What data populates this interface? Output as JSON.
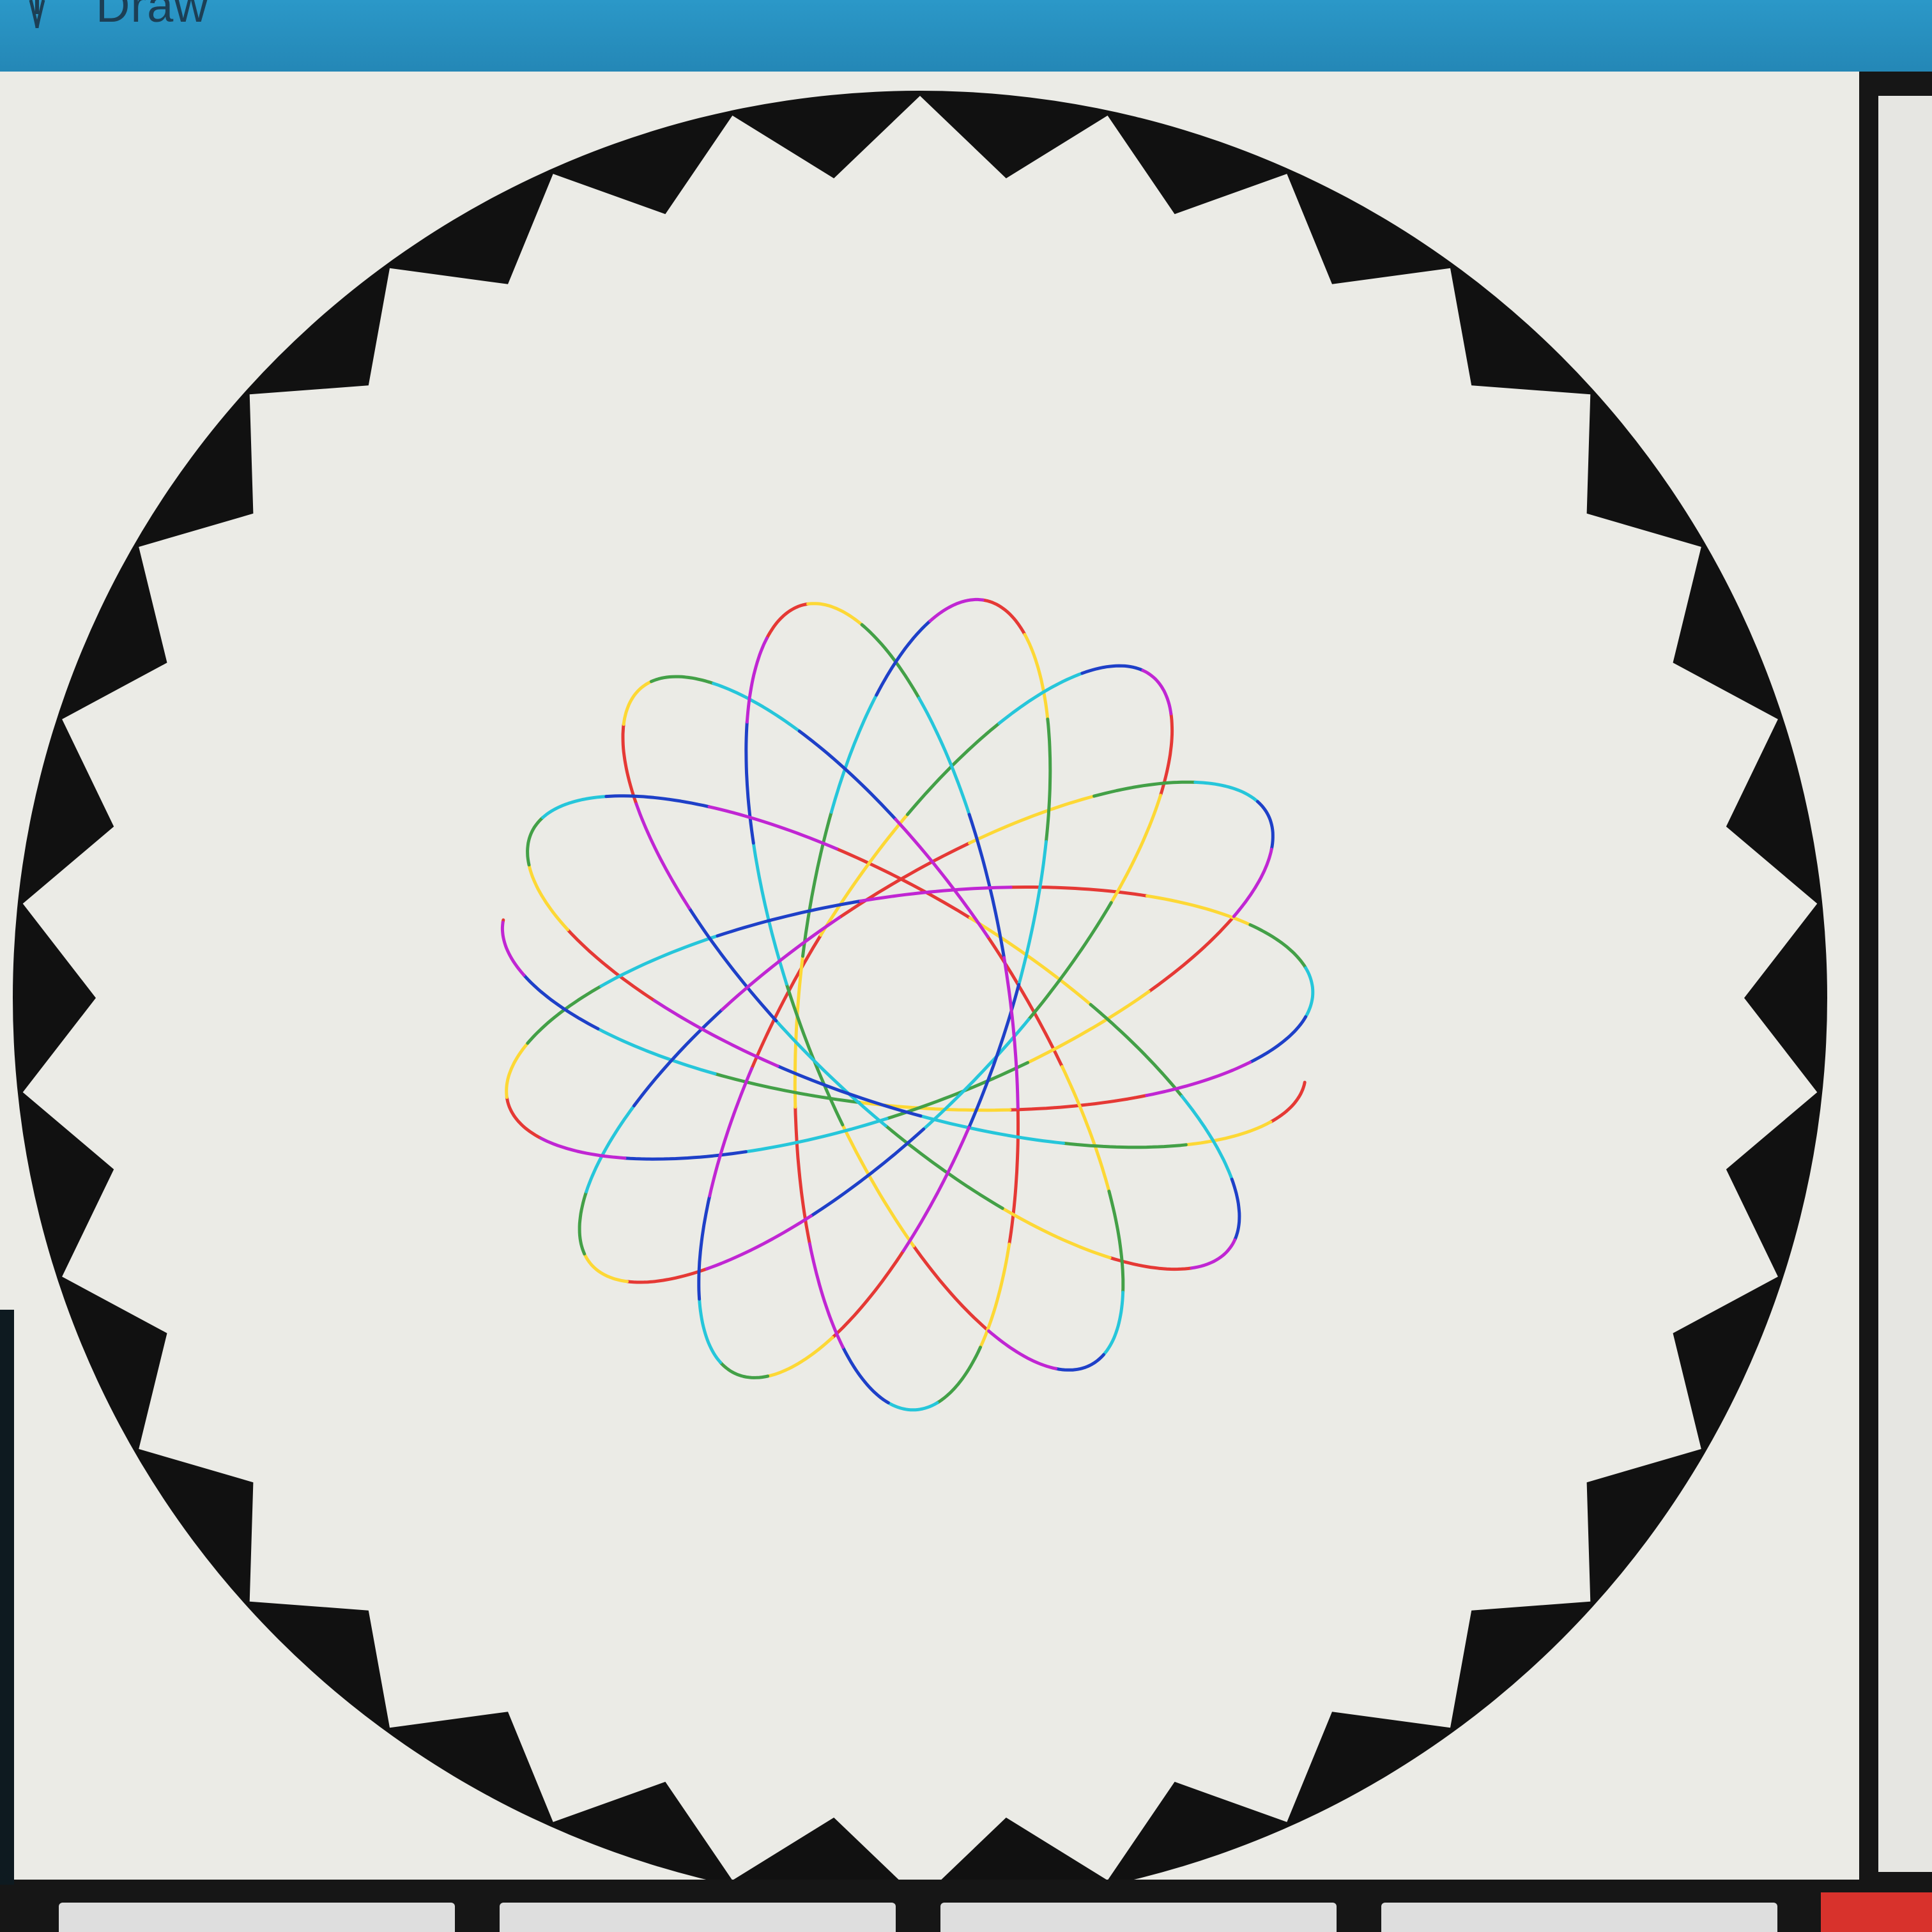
{
  "window": {
    "title": "Draw",
    "icon": "pen-icon"
  },
  "canvas": {
    "background_color": "#ebebe6",
    "ring": {
      "color": "#111111",
      "teeth_count": 30
    },
    "spirograph": {
      "petals": 7,
      "colors": [
        "#e53935",
        "#fdd835",
        "#43a047",
        "#26c6da",
        "#1e40c8",
        "#c026d3"
      ]
    }
  },
  "bottom_toolbar": {
    "buttons": [
      "",
      "",
      "",
      ""
    ],
    "accent_color": "#d8322c"
  }
}
